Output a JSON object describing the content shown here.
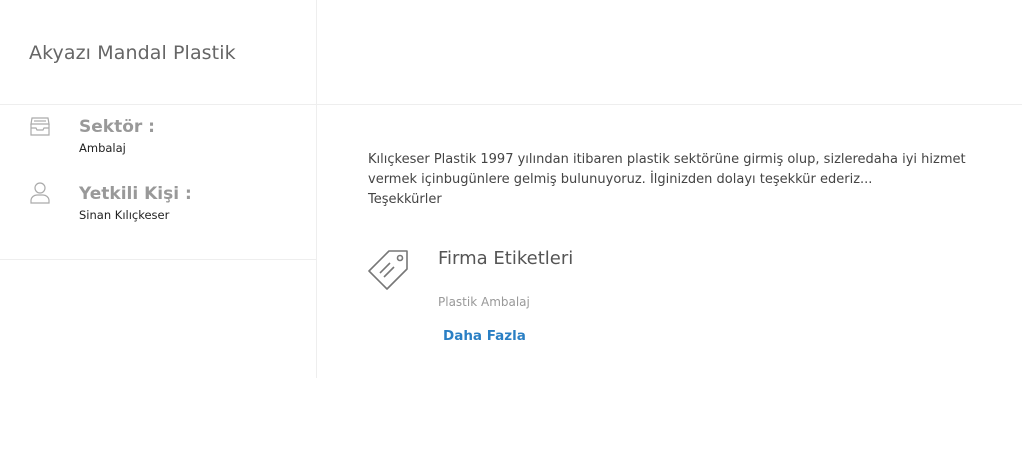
{
  "company": {
    "name": "Akyazı Mandal Plastik"
  },
  "info": {
    "sector": {
      "icon": "inbox-tray-icon",
      "label": "Sektör :",
      "value": "Ambalaj"
    },
    "contact": {
      "icon": "user-icon",
      "label": "Yetkili Kişi :",
      "value": "Sinan Kılıçkeser"
    }
  },
  "description": {
    "lines": [
      "Kılıçkeser Plastik 1997 yılından itibaren plastik sektörüne girmiş olup, sizleredaha iyi hizmet vermek içinbugünlere gelmiş bulunuyoruz. İlginizden dolayı teşekkür ederiz...",
      "Teşekkürler"
    ]
  },
  "tags": {
    "icon": "tag-icon",
    "title": "Firma Etiketleri",
    "items": [
      "Plastik Ambalaj"
    ],
    "more_label": "Daha Fazla"
  },
  "colors": {
    "link": "#2a7fc4",
    "label_gray": "#999999",
    "divider": "#eeeeee"
  }
}
